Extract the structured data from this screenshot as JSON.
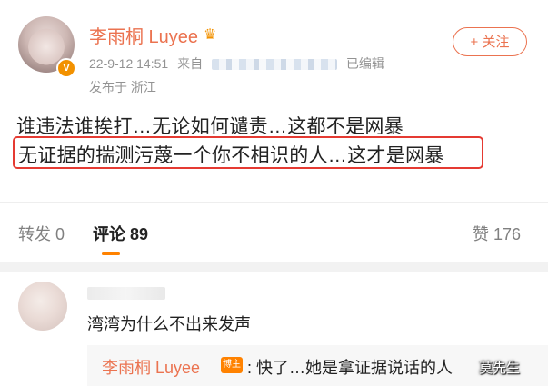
{
  "post": {
    "author": "李雨桐 Luyee",
    "date": "22-9-12 14:51",
    "from_label": "来自",
    "edited": "已编辑",
    "location": "发布于 浙江",
    "follow_label": "+ 关注",
    "line1": "谁违法谁挨打…无论如何谴责…这都不是网暴",
    "line2": "无证据的揣测污蔑一个你不相识的人…这才是网暴",
    "highlight_color": "#e53a32"
  },
  "tabs": {
    "repost": "转发 0",
    "comment": "评论 89",
    "like": "赞 176",
    "active_color": "#ff8200"
  },
  "comment": {
    "text": "湾湾为什么不出来发声",
    "reply": {
      "author": "李雨桐 Luyee",
      "badge": "博主",
      "text": ": 快了…她是拿证据说话的人"
    }
  },
  "watermark": "莫先生",
  "colors": {
    "accent": "#eb7350",
    "muted": "#939393",
    "text": "#222222"
  },
  "icons": {
    "crown": "crown-icon",
    "verified": "verified-v-icon"
  }
}
